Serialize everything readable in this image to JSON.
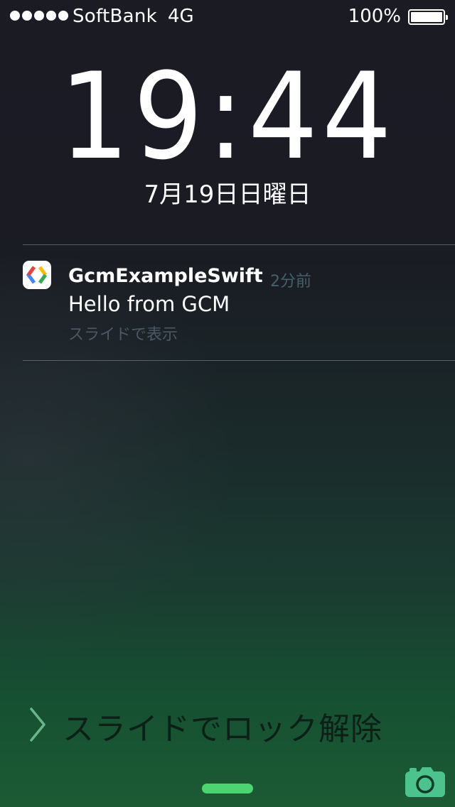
{
  "status_bar": {
    "carrier": "SoftBank",
    "network": "4G",
    "battery_percent": "100%",
    "signal_bars": 5,
    "battery_level": 1.0
  },
  "lock": {
    "time": "19:44",
    "date": "7月19日日曜日"
  },
  "notification": {
    "app_name": "GcmExampleSwift",
    "time_ago": "2分前",
    "message": "Hello from GCM",
    "action_hint": "スライドで表示",
    "icon": "chrome-gcm-icon"
  },
  "bottom": {
    "unlock_label": "スライドでロック解除",
    "camera_icon": "camera-icon",
    "accent_color": "#4cd471"
  }
}
